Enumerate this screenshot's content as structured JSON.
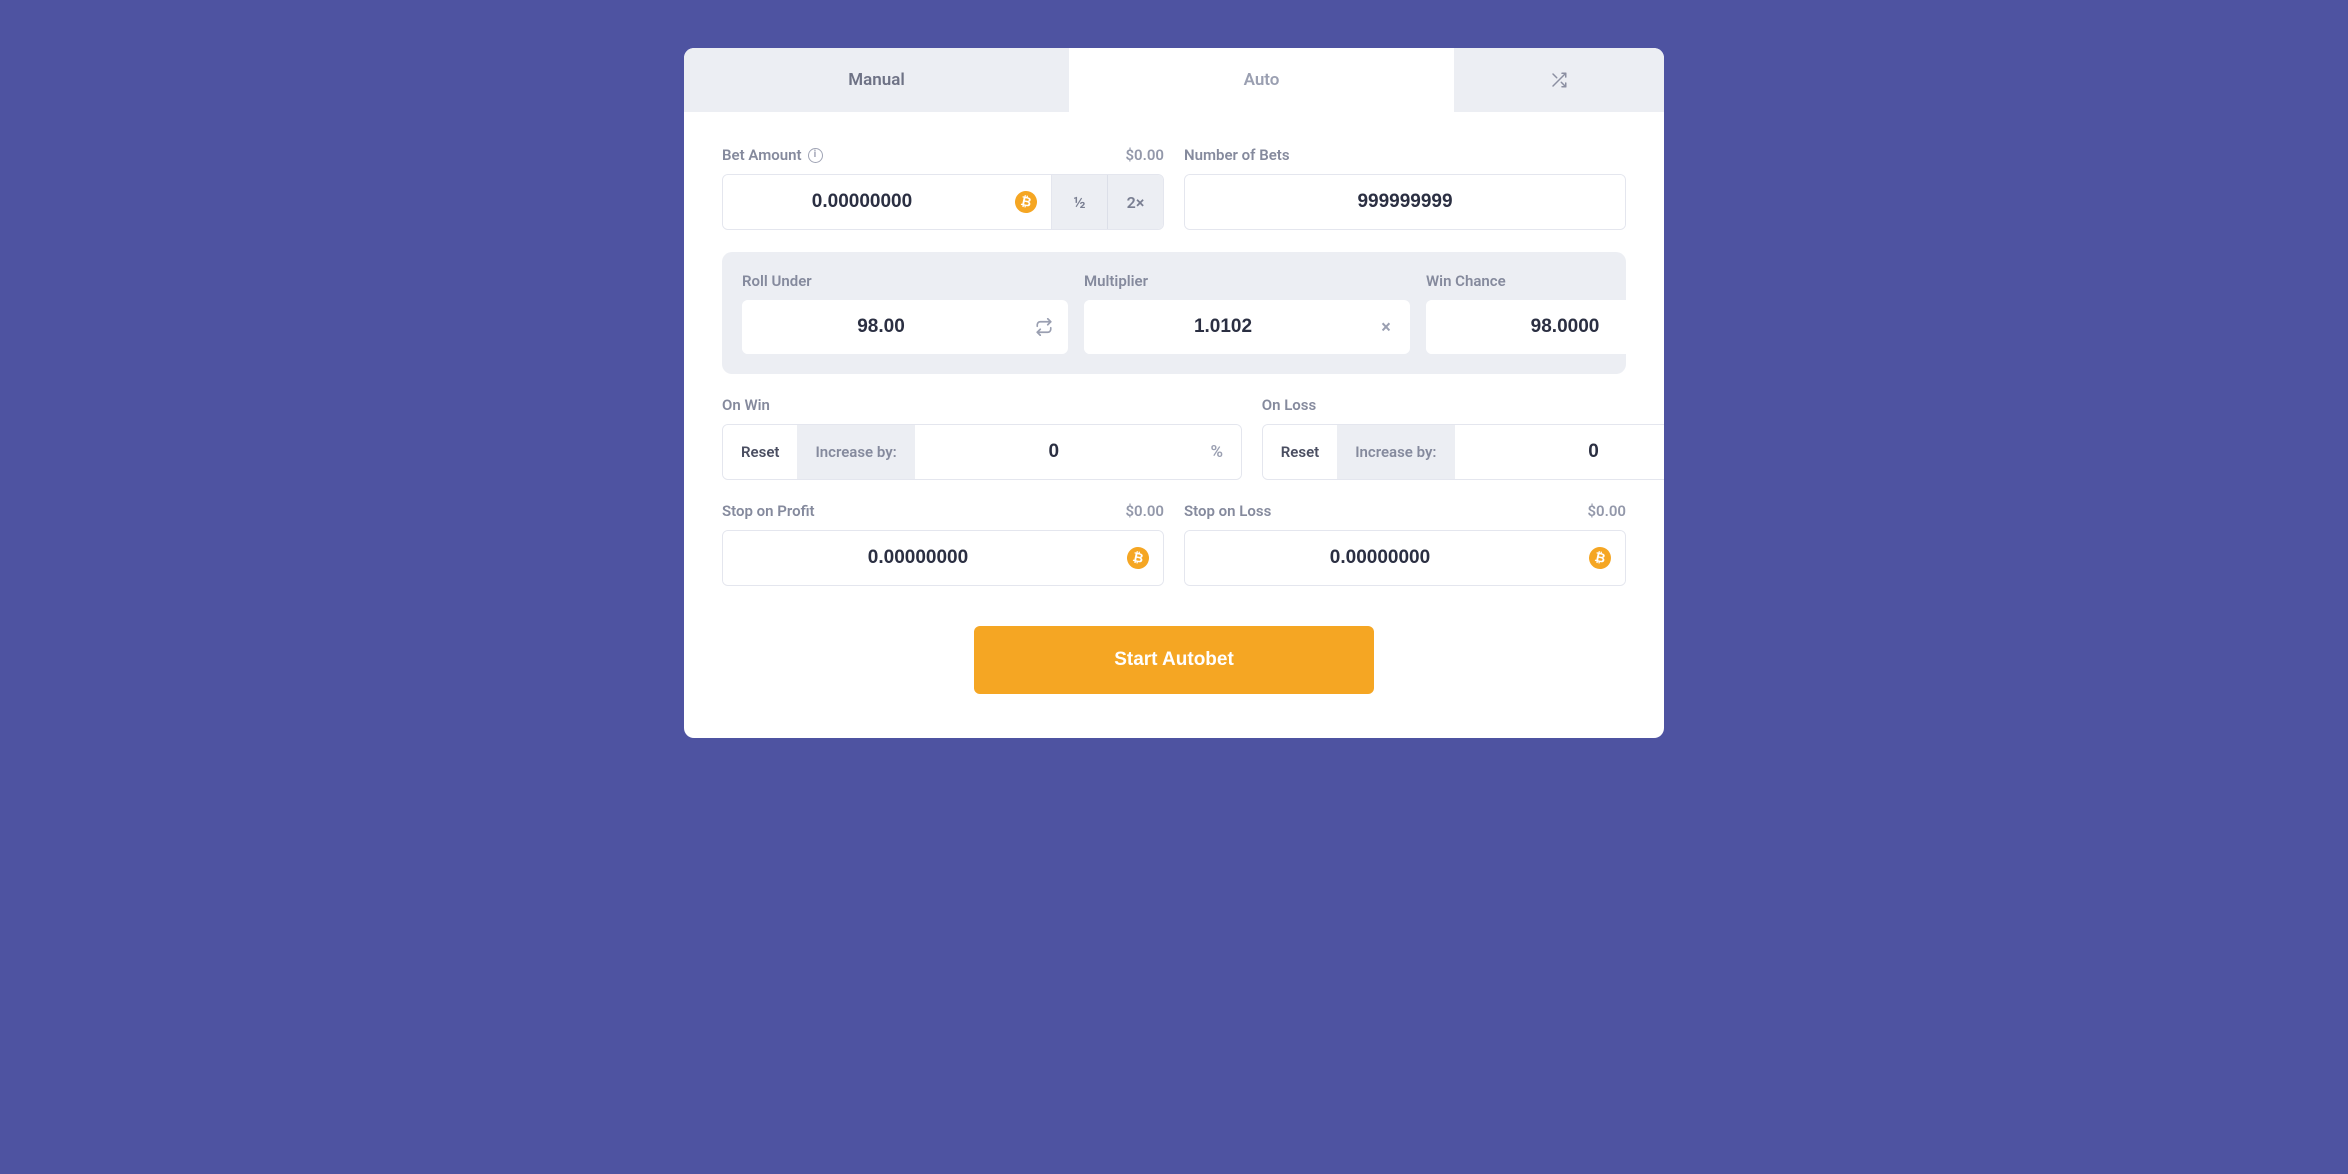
{
  "tabs": {
    "manual": "Manual",
    "auto": "Auto"
  },
  "betAmount": {
    "label": "Bet Amount",
    "usd": "$0.00",
    "value": "0.00000000",
    "half": "½",
    "double": "2×"
  },
  "numBets": {
    "label": "Number of Bets",
    "value": "999999999"
  },
  "rollUnder": {
    "label": "Roll Under",
    "value": "98.00"
  },
  "multiplier": {
    "label": "Multiplier",
    "value": "1.0102",
    "suffix": "×"
  },
  "winChance": {
    "label": "Win Chance",
    "value": "98.0000",
    "suffix": "%"
  },
  "onWin": {
    "label": "On Win",
    "reset": "Reset",
    "increase": "Increase by:",
    "value": "0",
    "suffix": "%"
  },
  "onLoss": {
    "label": "On Loss",
    "reset": "Reset",
    "increase": "Increase by:",
    "value": "0",
    "suffix": "%"
  },
  "stopProfit": {
    "label": "Stop on Profit",
    "usd": "$0.00",
    "value": "0.00000000"
  },
  "stopLoss": {
    "label": "Stop on Loss",
    "usd": "$0.00",
    "value": "0.00000000"
  },
  "startBtn": "Start Autobet"
}
